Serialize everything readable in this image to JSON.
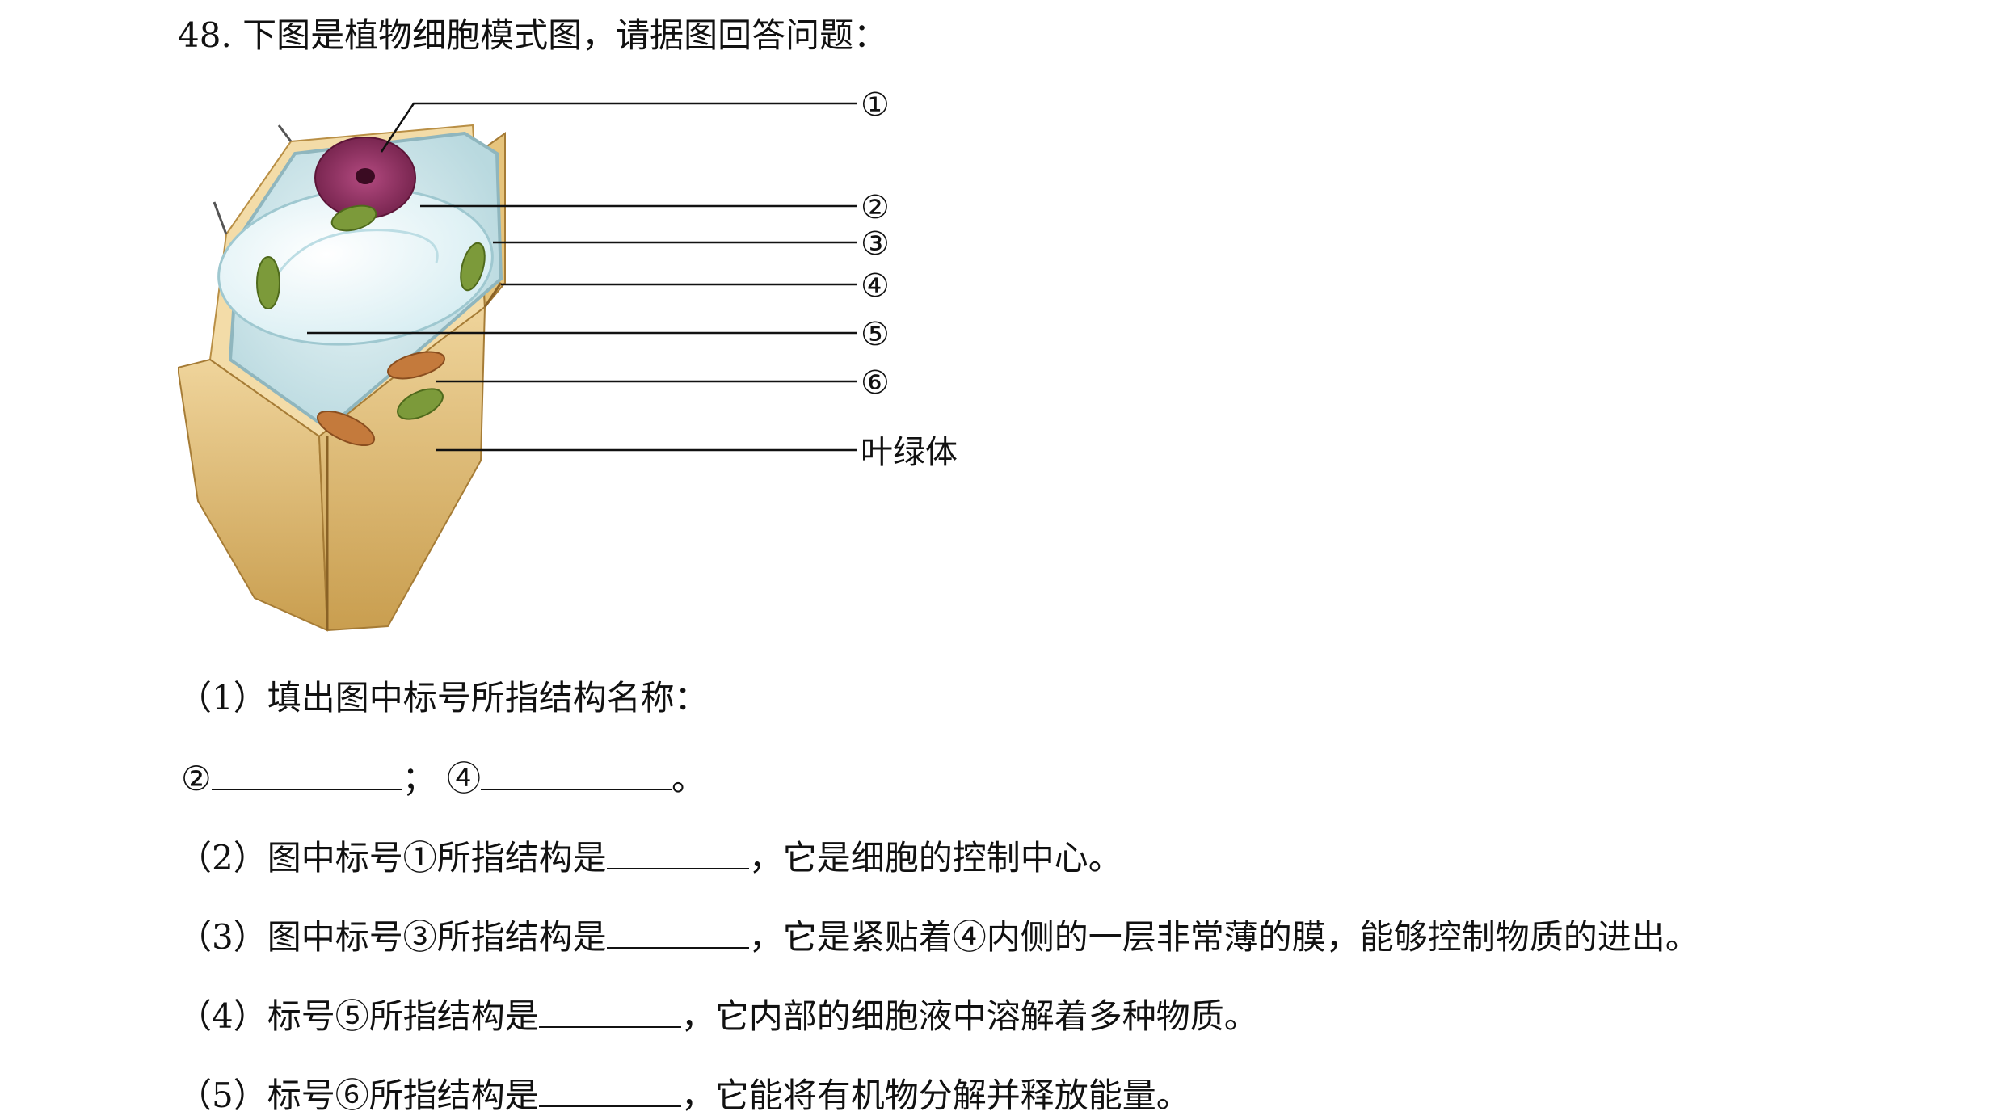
{
  "question": {
    "title": "48. 下图是植物细胞模式图，请据图回答问题："
  },
  "diagram": {
    "labels": [
      "①",
      "②",
      "③",
      "④",
      "⑤",
      "⑥"
    ],
    "chloroplast_label": "叶绿体",
    "colors": {
      "cell_wall": "#d9b56a",
      "cytoplasm": "#cfe6ea",
      "vacuole": "#e8f4f7",
      "nucleus": "#8e2a5c",
      "chloroplast": "#7c9a3a",
      "mitochondria": "#c47a3c"
    }
  },
  "items": {
    "q1_prompt": "（1）填出图中标号所指结构名称：",
    "q1_blank2_prefix": "②",
    "q1_sep": "；",
    "q1_blank4_prefix": "④",
    "q1_end": "。",
    "q2_prefix": "（2）图中标号①所指结构是",
    "q2_suffix": "，它是细胞的控制中心。",
    "q3_prefix": "（3）图中标号③所指结构是",
    "q3_suffix": "，它是紧贴着④内侧的一层非常薄的膜，能够控制物质的进出。",
    "q4_prefix": "（4）标号⑤所指结构是",
    "q4_suffix": "，它内部的细胞液中溶解着多种物质。",
    "q5_prefix": "（5）标号⑥所指结构是",
    "q5_suffix": "，它能将有机物分解并释放能量。"
  }
}
